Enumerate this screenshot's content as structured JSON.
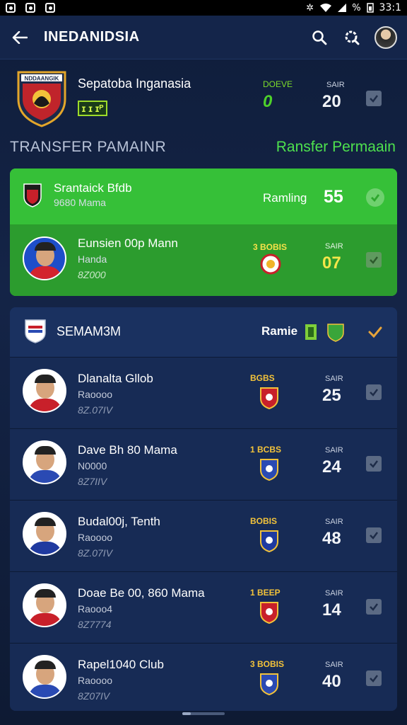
{
  "status_bar": {
    "time": "33:1",
    "battery": "%"
  },
  "appbar": {
    "title": "INEDANIDSIA"
  },
  "club": {
    "name": "Sepatoba Inganasia",
    "badge": "ɪ ɪ ɪᴾ",
    "logo_text": "NDDAANGIK",
    "stat1": {
      "label": "DOEVE",
      "value": "0"
    },
    "stat2": {
      "label": "SAIR",
      "value": "20"
    }
  },
  "section": {
    "title": "TRANSFER PAMAINR",
    "link": "Ransfer Permaain"
  },
  "featured": {
    "top": {
      "name": "Srantaick Bfdb",
      "sub": "9680 Mama",
      "label": "Ramling",
      "value": "55"
    },
    "bottom": {
      "name": "Eunsien 00p Mann",
      "sub": "Handa",
      "sub2": "8Z000",
      "club_label": "3 BOBIS",
      "stat_label": "SAIR",
      "value": "07"
    }
  },
  "list": {
    "header": {
      "title": "SEMAM3M",
      "label": "Ramie"
    },
    "rows": [
      {
        "name": "Dlanalta Gllob",
        "sub": "Raoooo",
        "sub2": "8Z.07IV",
        "club_label": "BGBS",
        "stat_label": "SAIR",
        "value": "25",
        "color": "#c8202a"
      },
      {
        "name": "Dave Bh 80 Mama",
        "sub": "N0000",
        "sub2": "8Z7IIV",
        "club_label": "1 BCBS",
        "stat_label": "SAIR",
        "value": "24",
        "color": "#2a4ab3"
      },
      {
        "name": "Budal00j, Tenth",
        "sub": "Raoooo",
        "sub2": "8Z.07IV",
        "club_label": "BOBIS",
        "stat_label": "SAIR",
        "value": "48",
        "color": "#1f3aa0"
      },
      {
        "name": "Doae Be 00, 860 Mama",
        "sub": "Raooo4",
        "sub2": "8Z7774",
        "club_label": "1 BEEP",
        "stat_label": "SAIR",
        "value": "14",
        "color": "#c8202a"
      },
      {
        "name": "Rapel1040 Club",
        "sub": "Raoooo",
        "sub2": "8Z07IV",
        "club_label": "3 BOBIS",
        "stat_label": "SAIR",
        "value": "40",
        "color": "#2a4ab3"
      }
    ]
  }
}
